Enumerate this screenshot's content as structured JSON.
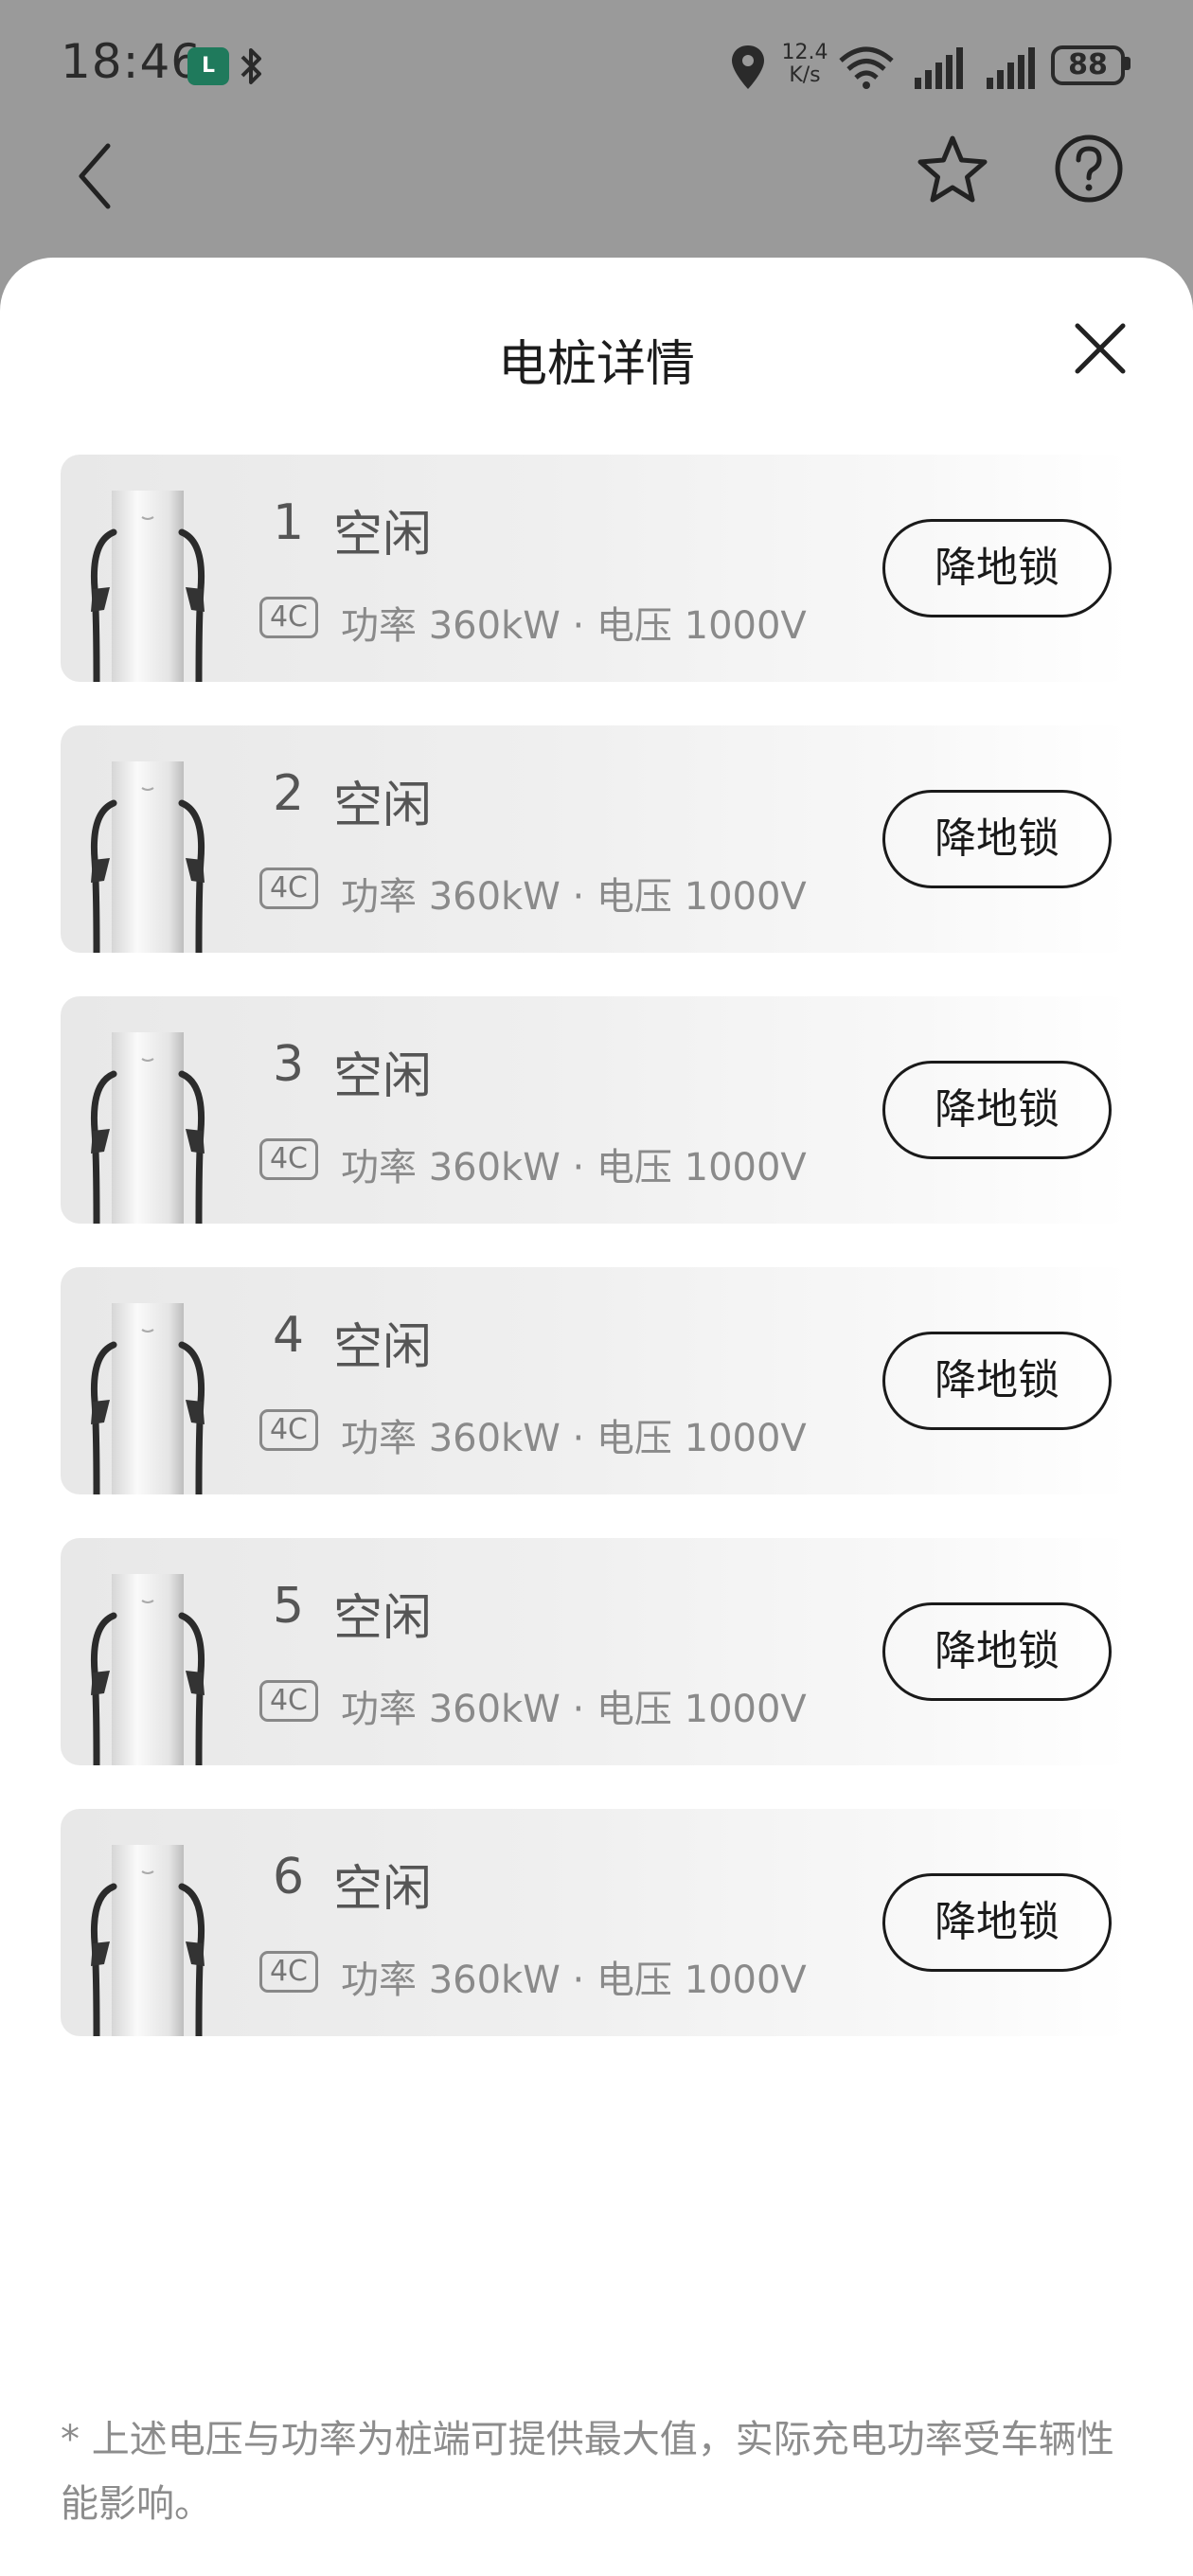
{
  "status_bar": {
    "time": "18:46",
    "app_badge": "L",
    "net_speed_value": "12.4",
    "net_speed_unit": "K/s",
    "battery": "88",
    "icons": [
      "location-icon",
      "wifi-icon",
      "signal-icon",
      "signal-icon",
      "battery-icon",
      "bluetooth-icon"
    ]
  },
  "nav": {
    "back_icon": "back-arrow-icon",
    "favorite_icon": "star-icon",
    "help_icon": "help-icon"
  },
  "sheet": {
    "title": "电桩详情",
    "close_icon": "close-icon"
  },
  "chargers": [
    {
      "number": "1",
      "status": "空闲",
      "tag": "4C",
      "spec": "功率 360kW · 电压 1000V",
      "button": "降地锁"
    },
    {
      "number": "2",
      "status": "空闲",
      "tag": "4C",
      "spec": "功率 360kW · 电压 1000V",
      "button": "降地锁"
    },
    {
      "number": "3",
      "status": "空闲",
      "tag": "4C",
      "spec": "功率 360kW · 电压 1000V",
      "button": "降地锁"
    },
    {
      "number": "4",
      "status": "空闲",
      "tag": "4C",
      "spec": "功率 360kW · 电压 1000V",
      "button": "降地锁"
    },
    {
      "number": "5",
      "status": "空闲",
      "tag": "4C",
      "spec": "功率 360kW · 电压 1000V",
      "button": "降地锁"
    },
    {
      "number": "6",
      "status": "空闲",
      "tag": "4C",
      "spec": "功率 360kW · 电压 1000V",
      "button": "降地锁"
    }
  ],
  "footnote": "* 上述电压与功率为桩端可提供最大值，实际充电功率受车辆性能影响。",
  "colors": {
    "overlay": "#9a9a9a",
    "sheet": "#ffffff",
    "text": "#1c1c1c",
    "muted": "#8a8a8a"
  }
}
